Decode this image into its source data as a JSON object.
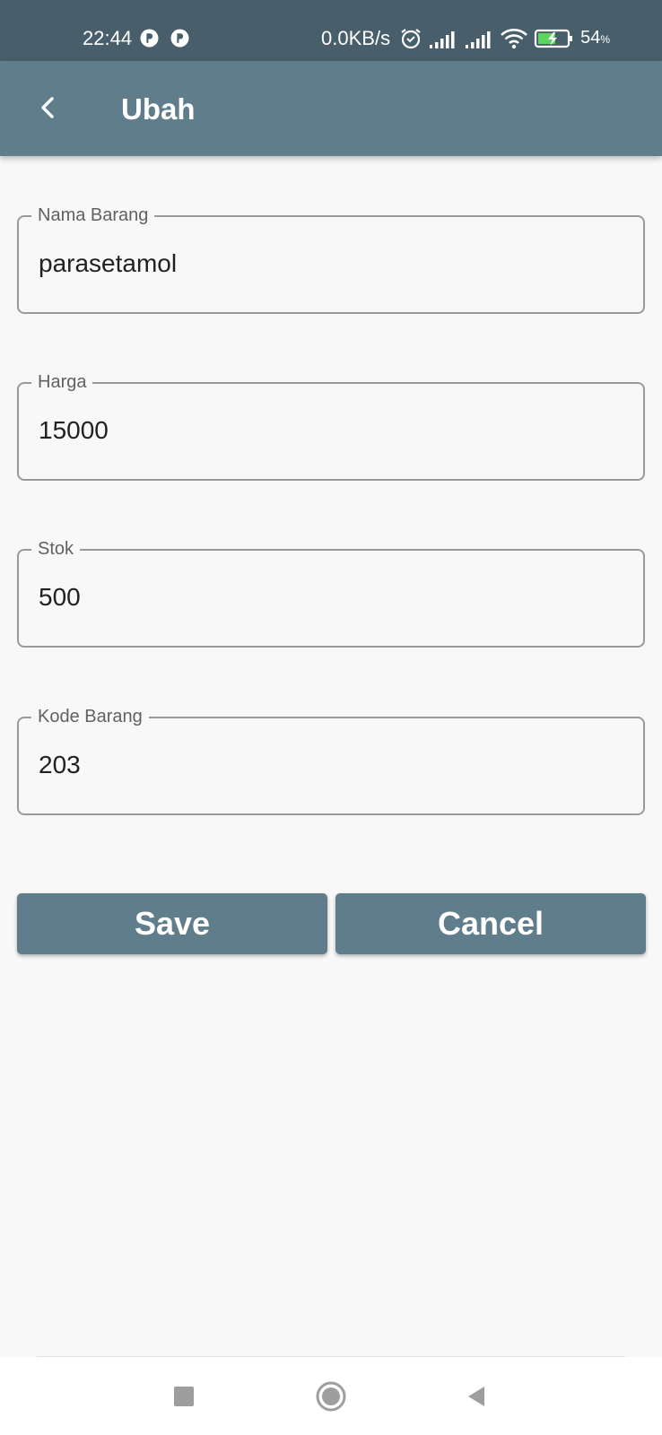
{
  "status_bar": {
    "time": "22:44",
    "network_speed": "0.0KB/s",
    "battery_percent": "54",
    "battery_unit": "%",
    "icons": [
      "app-notification-icon",
      "app-notification-icon",
      "alarm-icon",
      "signal-icon",
      "signal-icon",
      "wifi-icon",
      "battery-charging-icon"
    ]
  },
  "app_bar": {
    "title": "Ubah",
    "back_icon": "chevron-left-icon",
    "background": "#607d8b"
  },
  "form": {
    "fields": [
      {
        "label": "Nama Barang",
        "value": "parasetamol"
      },
      {
        "label": "Harga",
        "value": "15000"
      },
      {
        "label": "Stok",
        "value": "500"
      },
      {
        "label": "Kode Barang",
        "value": "203"
      }
    ]
  },
  "actions": {
    "save_label": "Save",
    "cancel_label": "Cancel",
    "color": "#607d8b"
  },
  "nav_bar": {
    "icons": [
      "recents-square-icon",
      "home-circle-icon",
      "back-triangle-icon"
    ]
  }
}
